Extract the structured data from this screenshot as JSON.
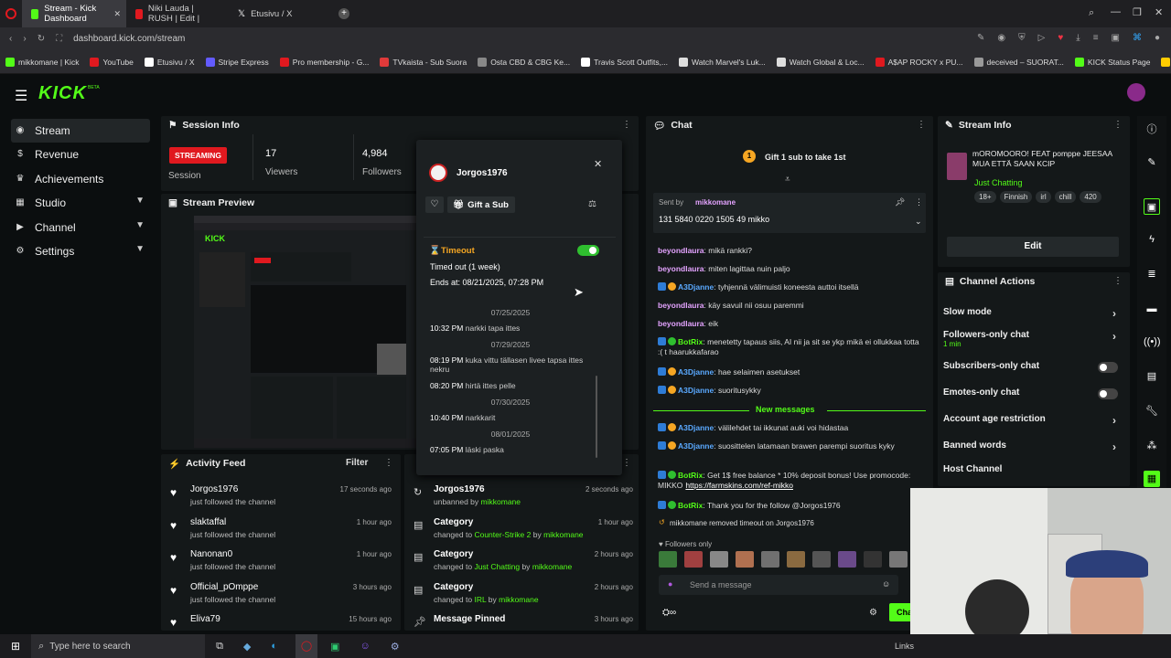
{
  "browser": {
    "tabs": [
      {
        "label": "Stream - Kick Dashboard",
        "color": "#53fc18"
      },
      {
        "label": "Niki Lauda | RUSH | Edit |",
        "color": "#e0191f"
      },
      {
        "label": "Etusivu / X",
        "color": "#ffffff"
      }
    ],
    "url": "dashboard.kick.com/stream",
    "bookmarks": [
      {
        "label": "mikkomane | Kick",
        "color": "#53fc18"
      },
      {
        "label": "YouTube",
        "color": "#e0191f"
      },
      {
        "label": "Etusivu / X",
        "color": "#ffffff"
      },
      {
        "label": "Stripe Express",
        "color": "#635bff"
      },
      {
        "label": "Pro membership - G...",
        "color": "#e0191f"
      },
      {
        "label": "TVkaista - Sub Suora",
        "color": "#e03a3a"
      },
      {
        "label": "Osta CBD & CBG Ke...",
        "color": "#888888"
      },
      {
        "label": "Travis Scott Outfits,...",
        "color": "#ffffff"
      },
      {
        "label": "Watch Marvel's Luk...",
        "color": "#dddddd"
      },
      {
        "label": "Watch Global & Loc...",
        "color": "#dddddd"
      },
      {
        "label": "A$AP ROCKY x PU...",
        "color": "#e0191f"
      },
      {
        "label": "deceived – SUORAT...",
        "color": "#999999"
      },
      {
        "label": "KICK Status Page",
        "color": "#53fc18"
      },
      {
        "label": "Oleksandr Usyk vs D...",
        "color": "#ffcc00"
      }
    ]
  },
  "kick": {
    "logo": "KICK",
    "logo_beta": "BETA",
    "accent": "#53fc18"
  },
  "sidebar": {
    "items": [
      {
        "label": "Stream",
        "icon": "broadcast-icon"
      },
      {
        "label": "Revenue",
        "icon": "dollar-icon"
      },
      {
        "label": "Achievements",
        "icon": "trophy-icon"
      },
      {
        "label": "Studio",
        "icon": "studio-icon"
      },
      {
        "label": "Channel",
        "icon": "channel-icon"
      },
      {
        "label": "Settings",
        "icon": "gear-icon"
      }
    ]
  },
  "session": {
    "title": "Session Info",
    "status": "STREAMING",
    "status_sub": "Session",
    "viewers_value": "17",
    "viewers_label": "Viewers",
    "followers_value": "4,984",
    "followers_label": "Followers"
  },
  "preview": {
    "title": "Stream Preview"
  },
  "activity": {
    "title": "Activity Feed",
    "filter": "Filter",
    "items": [
      {
        "name": "Jorgos1976",
        "action": "just followed the channel",
        "time": "17 seconds ago"
      },
      {
        "name": "slaktaffal",
        "action": "just followed the channel",
        "time": "1 hour ago"
      },
      {
        "name": "Nanonan0",
        "action": "just followed the channel",
        "time": "1 hour ago"
      },
      {
        "name": "Official_pOmppe",
        "action": "just followed the channel",
        "time": "3 hours ago"
      },
      {
        "name": "Eliva79",
        "action": "",
        "time": "15 hours ago"
      }
    ]
  },
  "modlog": {
    "items": [
      {
        "title": "Jorgos1976",
        "pre": "unbanned by",
        "hl": "mikkomane",
        "mid": "",
        "hl2": "",
        "time": "2 seconds ago"
      },
      {
        "title": "Category",
        "pre": "changed to",
        "hl": "Counter-Strike 2",
        "mid": "by",
        "hl2": "mikkomane",
        "time": "1 hour ago"
      },
      {
        "title": "Category",
        "pre": "changed to",
        "hl": "Just Chatting",
        "mid": "by",
        "hl2": "mikkomane",
        "time": "2 hours ago"
      },
      {
        "title": "Category",
        "pre": "changed to",
        "hl": "IRL",
        "mid": "by",
        "hl2": "mikkomane",
        "time": "2 hours ago"
      },
      {
        "title": "Message Pinned",
        "pre": "",
        "hl": "",
        "mid": "",
        "hl2": "",
        "time": "3 hours ago"
      }
    ]
  },
  "usercard": {
    "username": "Jorgos1976",
    "gift_label": "Gift a Sub",
    "timeout_label": "Timeout",
    "timeout_text": "Timed out (1 week)",
    "ends_text": "Ends at: 08/21/2025, 07:28 PM",
    "history": [
      {
        "type": "date",
        "text": "07/25/2025"
      },
      {
        "type": "msg",
        "time": "10:32 PM",
        "text": "narkki tapa ittes"
      },
      {
        "type": "date",
        "text": "07/29/2025"
      },
      {
        "type": "msg",
        "time": "08:19 PM",
        "text": "kuka vittu tällasen livee tapsa ittes nekru"
      },
      {
        "type": "msg",
        "time": "08:20 PM",
        "text": "hirtä ittes pelle"
      },
      {
        "type": "date",
        "text": "07/30/2025"
      },
      {
        "type": "msg",
        "time": "10:40 PM",
        "text": "narkkarit"
      },
      {
        "type": "date",
        "text": "08/01/2025"
      },
      {
        "type": "msg",
        "time": "07:05 PM",
        "text": "läski paska"
      }
    ]
  },
  "chat": {
    "title": "Chat",
    "gift_banner": "Gift 1 sub to take 1st",
    "gift_count": "1",
    "pinned_sentby": "Sent by",
    "pinned_user": "mikkomane",
    "pinned_text": "131 5840 0220 1505 49 mikko",
    "messages": [
      {
        "user": "beyondlaura",
        "text": "mikä rankki?",
        "badges": []
      },
      {
        "user": "beyondlaura",
        "text": "miten lagittaa nuin paljo",
        "badges": []
      },
      {
        "user": "A3Djanne",
        "text": "tyhjennä välimuisti koneesta auttoi itsellä",
        "badges": [
          "blue",
          "or"
        ]
      },
      {
        "user": "beyondlaura",
        "text": "käy savuil nii osuu paremmi",
        "badges": []
      },
      {
        "user": "beyondlaura",
        "text": "eik",
        "badges": []
      },
      {
        "user": "BotRix",
        "text": "menetetty tapaus siis, AI nii ja sit se ykp mikä ei ollukkaa totta :( t haarukkafarao",
        "badges": [
          "blue",
          "green"
        ]
      },
      {
        "user": "A3Djanne",
        "text": "hae selaimen asetukset",
        "badges": [
          "blue",
          "or"
        ]
      },
      {
        "user": "A3Djanne",
        "text": "suoritusykky",
        "badges": [
          "blue",
          "or"
        ]
      }
    ],
    "new_messages_label": "New messages",
    "messages2": [
      {
        "user": "A3Djanne",
        "text": "välilehdet tai ikkunat auki voi hidastaa",
        "badges": [
          "blue",
          "or"
        ]
      },
      {
        "user": "A3Djanne",
        "text": "suosittelen latamaan brawen parempi suoritus kyky",
        "badges": [
          "blue",
          "or"
        ]
      },
      {
        "user": "BotRix",
        "text": "Get 1$ free balance * 10% deposit bonus! Use promocode: MIKKO",
        "link": "https://farmskins.com/ref-mikko",
        "badges": [
          "blue",
          "green"
        ]
      },
      {
        "user": "BotRix",
        "text": "Thank you for the follow @Jorgos1976",
        "badges": [
          "blue",
          "green"
        ]
      }
    ],
    "system_msg": "mikkomane removed timeout on Jorgos1976",
    "followers_only": "Followers only",
    "input_placeholder": "Send a message",
    "chat_button": "Chat"
  },
  "streaminfo": {
    "title": "Stream Info",
    "stream_title": "mOROMOORO! FEAT pomppe JEESAA MUA ETTÄ SAAN KCIP",
    "category": "Just Chatting",
    "tags": [
      "18+",
      "Finnish",
      "irl",
      "chill",
      "420"
    ],
    "edit_label": "Edit"
  },
  "channel_actions": {
    "title": "Channel Actions",
    "items": [
      {
        "label": "Slow mode",
        "sub": "",
        "control": "chevron"
      },
      {
        "label": "Followers-only chat",
        "sub": "1 min",
        "control": "chevron"
      },
      {
        "label": "Subscribers-only chat",
        "sub": "",
        "control": "toggle"
      },
      {
        "label": "Emotes-only chat",
        "sub": "",
        "control": "toggle"
      },
      {
        "label": "Account age restriction",
        "sub": "",
        "control": "chevron"
      },
      {
        "label": "Banned words",
        "sub": "",
        "control": "chevron"
      },
      {
        "label": "Host Channel",
        "sub": "",
        "control": "none"
      }
    ]
  },
  "taskbar": {
    "search_placeholder": "Type here to search",
    "tray_text": "Links"
  }
}
